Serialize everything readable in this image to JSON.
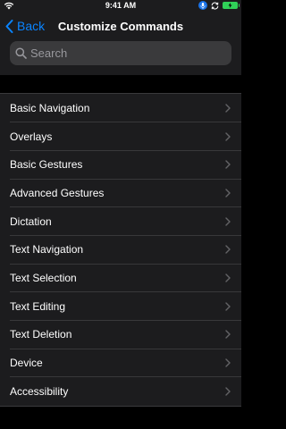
{
  "status_bar": {
    "time": "9:41 AM"
  },
  "nav": {
    "back_label": "Back",
    "title": "Customize Commands"
  },
  "search": {
    "placeholder": "Search"
  },
  "commands": {
    "items": [
      {
        "label": "Basic Navigation"
      },
      {
        "label": "Overlays"
      },
      {
        "label": "Basic Gestures"
      },
      {
        "label": "Advanced Gestures"
      },
      {
        "label": "Dictation"
      },
      {
        "label": "Text Navigation"
      },
      {
        "label": "Text Selection"
      },
      {
        "label": "Text Editing"
      },
      {
        "label": "Text Deletion"
      },
      {
        "label": "Device"
      },
      {
        "label": "Accessibility"
      }
    ]
  },
  "colors": {
    "accent": "#0a84ff",
    "battery": "#30d158",
    "mic": "#1a73e8"
  },
  "icons": [
    "wifi-icon",
    "mic-icon",
    "sync-icon",
    "battery-charging-icon",
    "back-chevron-icon",
    "search-icon",
    "chevron-right-icon"
  ]
}
